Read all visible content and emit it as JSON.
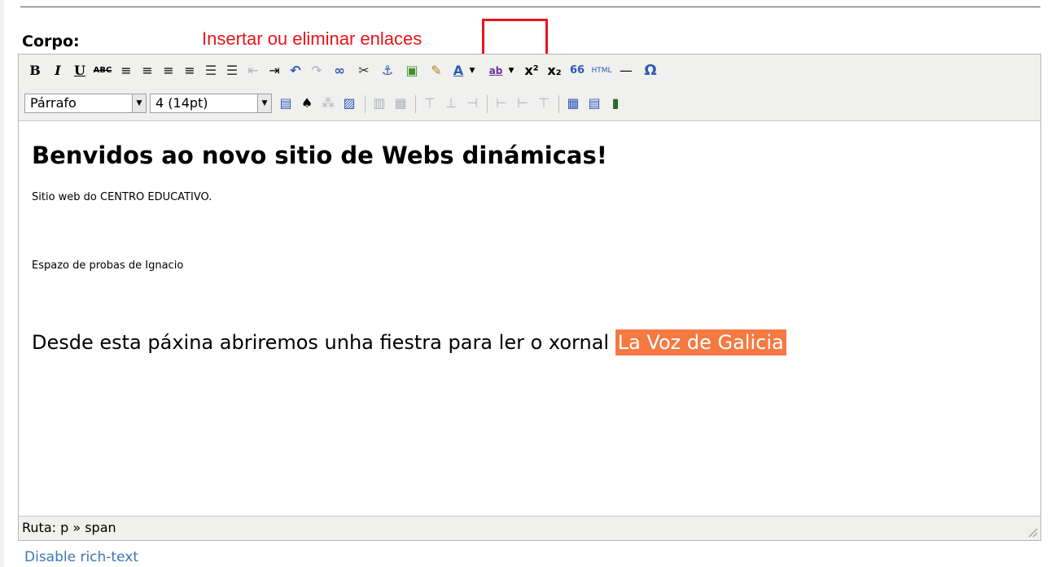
{
  "form": {
    "body_label": "Corpo:",
    "disable_link": "Disable rich-text"
  },
  "annotation": {
    "callout_text": "Insertar ou eliminar enlaces",
    "color": "#e8141b"
  },
  "toolbar": {
    "row1": [
      {
        "name": "bold-button",
        "glyph": "B"
      },
      {
        "name": "italic-button",
        "glyph": "I"
      },
      {
        "name": "underline-button",
        "glyph": "U"
      },
      {
        "name": "strikethrough-button",
        "glyph": "ABC"
      },
      {
        "name": "align-left-icon",
        "glyph": "≡"
      },
      {
        "name": "align-center-icon",
        "glyph": "≡"
      },
      {
        "name": "align-right-icon",
        "glyph": "≡"
      },
      {
        "name": "align-justify-icon",
        "glyph": "≡"
      },
      {
        "name": "bullet-list-icon",
        "glyph": "☰"
      },
      {
        "name": "numbered-list-icon",
        "glyph": "☰"
      },
      {
        "name": "outdent-icon",
        "glyph": "⇤"
      },
      {
        "name": "indent-icon",
        "glyph": "⇥"
      },
      {
        "name": "undo-icon",
        "glyph": "↶"
      },
      {
        "name": "redo-icon",
        "glyph": "↷"
      },
      {
        "name": "link-icon",
        "glyph": "∞"
      },
      {
        "name": "unlink-icon",
        "glyph": "✂"
      },
      {
        "name": "anchor-icon",
        "glyph": "⚓"
      },
      {
        "name": "image-icon",
        "glyph": "▣"
      },
      {
        "name": "cleanup-icon",
        "glyph": "✎"
      },
      {
        "name": "text-color-icon",
        "glyph": "A"
      },
      {
        "name": "highlight-color-icon",
        "glyph": "ab"
      },
      {
        "name": "superscript-icon",
        "glyph": "x²"
      },
      {
        "name": "subscript-icon",
        "glyph": "x₂"
      },
      {
        "name": "blockquote-icon",
        "glyph": "66"
      },
      {
        "name": "html-source-icon",
        "glyph": "HTML"
      },
      {
        "name": "horizontal-rule-icon",
        "glyph": "—"
      },
      {
        "name": "special-char-icon",
        "glyph": "Ω"
      }
    ],
    "format_select": "Párrafo",
    "size_select": "4 (14pt)",
    "row2_icons": [
      {
        "name": "fullscreen-icon",
        "glyph": "▤"
      },
      {
        "name": "search-replace-icon",
        "glyph": "♠"
      },
      {
        "name": "spellcheck-icon",
        "glyph": "⁂"
      },
      {
        "name": "edit-css-icon",
        "glyph": "▨"
      },
      {
        "name": "table-row-props-icon",
        "glyph": "▥"
      },
      {
        "name": "table-cell-props-icon",
        "glyph": "▦"
      },
      {
        "name": "insert-row-before-icon",
        "glyph": "⊤"
      },
      {
        "name": "insert-row-after-icon",
        "glyph": "⊥"
      },
      {
        "name": "delete-row-icon",
        "glyph": "⊣"
      },
      {
        "name": "insert-col-before-icon",
        "glyph": "⊢"
      },
      {
        "name": "insert-col-after-icon",
        "glyph": "⊢"
      },
      {
        "name": "delete-col-icon",
        "glyph": "⊤"
      },
      {
        "name": "table-icon",
        "glyph": "▦"
      },
      {
        "name": "table-props-icon",
        "glyph": "▤"
      },
      {
        "name": "media-icon",
        "glyph": "▮"
      }
    ]
  },
  "editor_content": {
    "heading": "Benvidos ao novo sitio de Webs dinámicas!",
    "line1": "Sitio web do CENTRO EDUCATIVO.",
    "line2": "Espazo de probas de Ignacio",
    "line3_prefix": "Desde esta páxina abriremos unha fiestra para ler o xornal ",
    "line3_link": "La Voz de Galicia",
    "highlight_color": "#f47a42"
  },
  "statusbar": {
    "path": "Ruta: p » span"
  }
}
